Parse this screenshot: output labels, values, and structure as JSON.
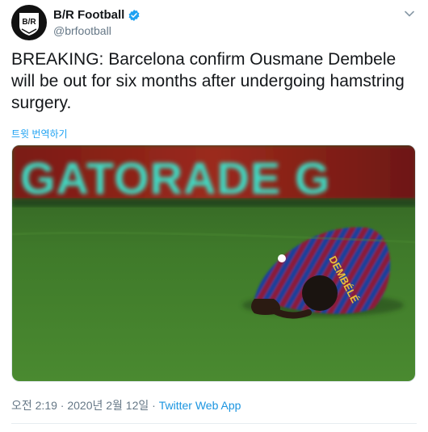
{
  "account": {
    "display_name": "B/R Football",
    "handle": "@brfootball",
    "avatar_text": "B/R",
    "verified": true
  },
  "tweet": {
    "text": "BREAKING: Barcelona confirm Ousmane Dembele will be out for six months after undergoing hamstring surgery.",
    "translate_label": "트윗 번역하기"
  },
  "photo": {
    "banner_text": "GATORADE G",
    "jersey_text": "DEMBÉLÉ",
    "icon": "photo-player-on-pitch"
  },
  "meta": {
    "timestamp": "오전 2:19 · 2020년 2월 12일",
    "separator": " · ",
    "app": "Twitter Web App"
  },
  "colors": {
    "link": "#1da1f2",
    "verified": "#1da1f2",
    "secondary_text": "#657786"
  }
}
